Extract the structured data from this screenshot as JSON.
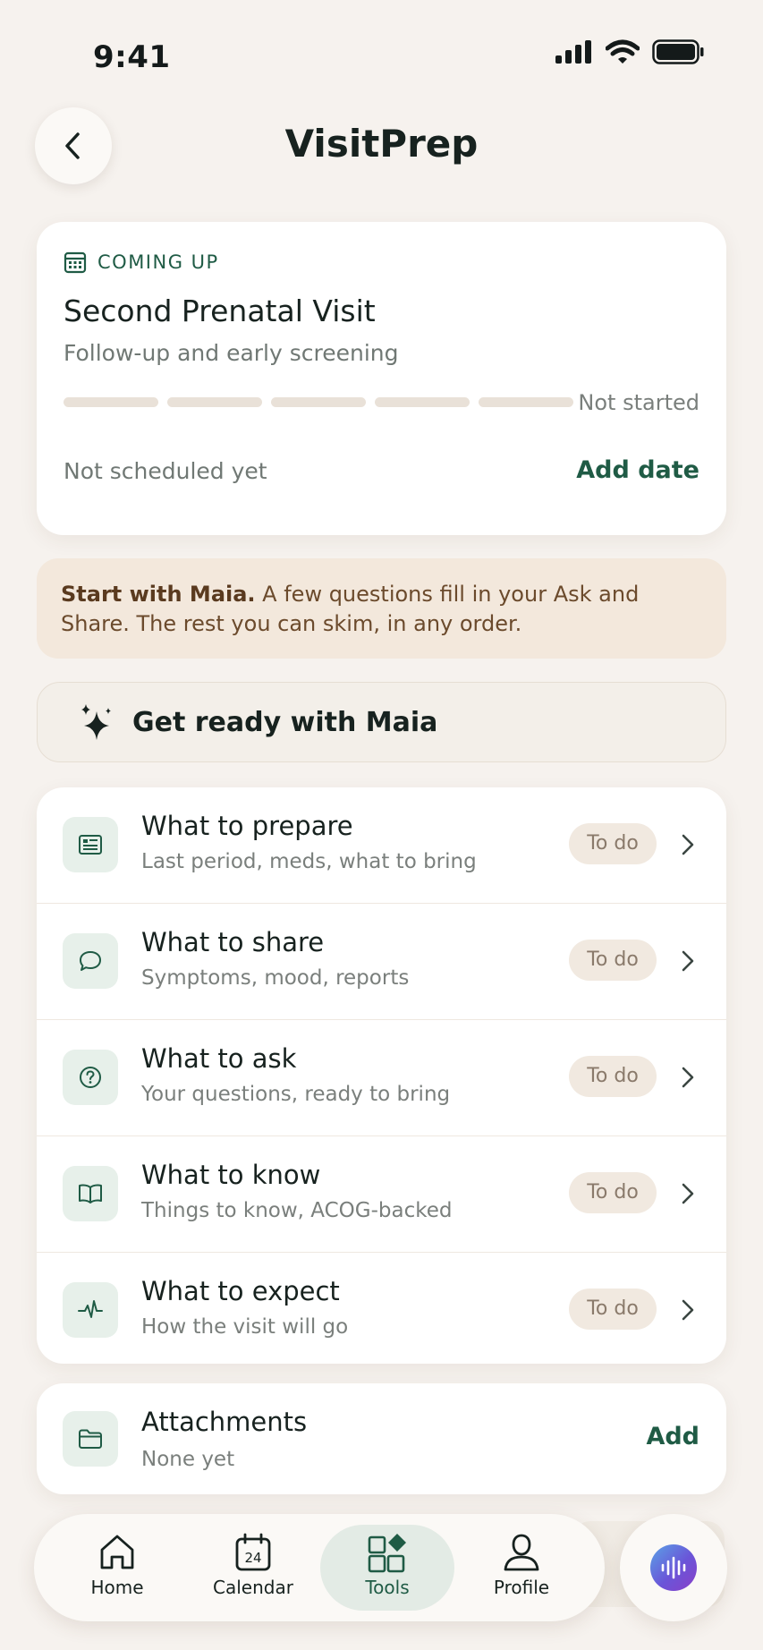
{
  "status_bar": {
    "time": "9:41"
  },
  "header": {
    "title": "VisitPrep"
  },
  "visit": {
    "label": "COMING UP",
    "title": "Second Prenatal Visit",
    "subtitle": "Follow-up and early screening",
    "progress_segments": 5,
    "progress_completed": 0,
    "progress_status": "Not started",
    "schedule_text": "Not scheduled yet",
    "add_date_label": "Add date"
  },
  "hint": {
    "bold": "Start with Maia.",
    "text": " A few questions fill in your Ask and Share. The rest you can skim, in any order."
  },
  "maia_button": {
    "label": "Get ready with Maia"
  },
  "sections": [
    {
      "title": "What to prepare",
      "subtitle": "Last period, meds, what to bring",
      "status": "To do",
      "icon": "document-icon"
    },
    {
      "title": "What to share",
      "subtitle": "Symptoms, mood, reports",
      "status": "To do",
      "icon": "chat-bubble-icon"
    },
    {
      "title": "What to ask",
      "subtitle": "Your questions, ready to bring",
      "status": "To do",
      "icon": "question-icon"
    },
    {
      "title": "What to know",
      "subtitle": "Things to know, ACOG-backed",
      "status": "To do",
      "icon": "book-icon"
    },
    {
      "title": "What to expect",
      "subtitle": "How the visit will go",
      "status": "To do",
      "icon": "pulse-icon"
    }
  ],
  "attachments": {
    "title": "Attachments",
    "subtitle": "None yet",
    "add_label": "Add"
  },
  "nav": {
    "home": "Home",
    "calendar": "Calendar",
    "calendar_day": "24",
    "tools": "Tools",
    "profile": "Profile",
    "active": "tools"
  },
  "colors": {
    "background": "#f6f2ee",
    "accent": "#1f5b45",
    "hint_bg": "#f3e8dc",
    "badge_bg": "#f1e9e0"
  }
}
